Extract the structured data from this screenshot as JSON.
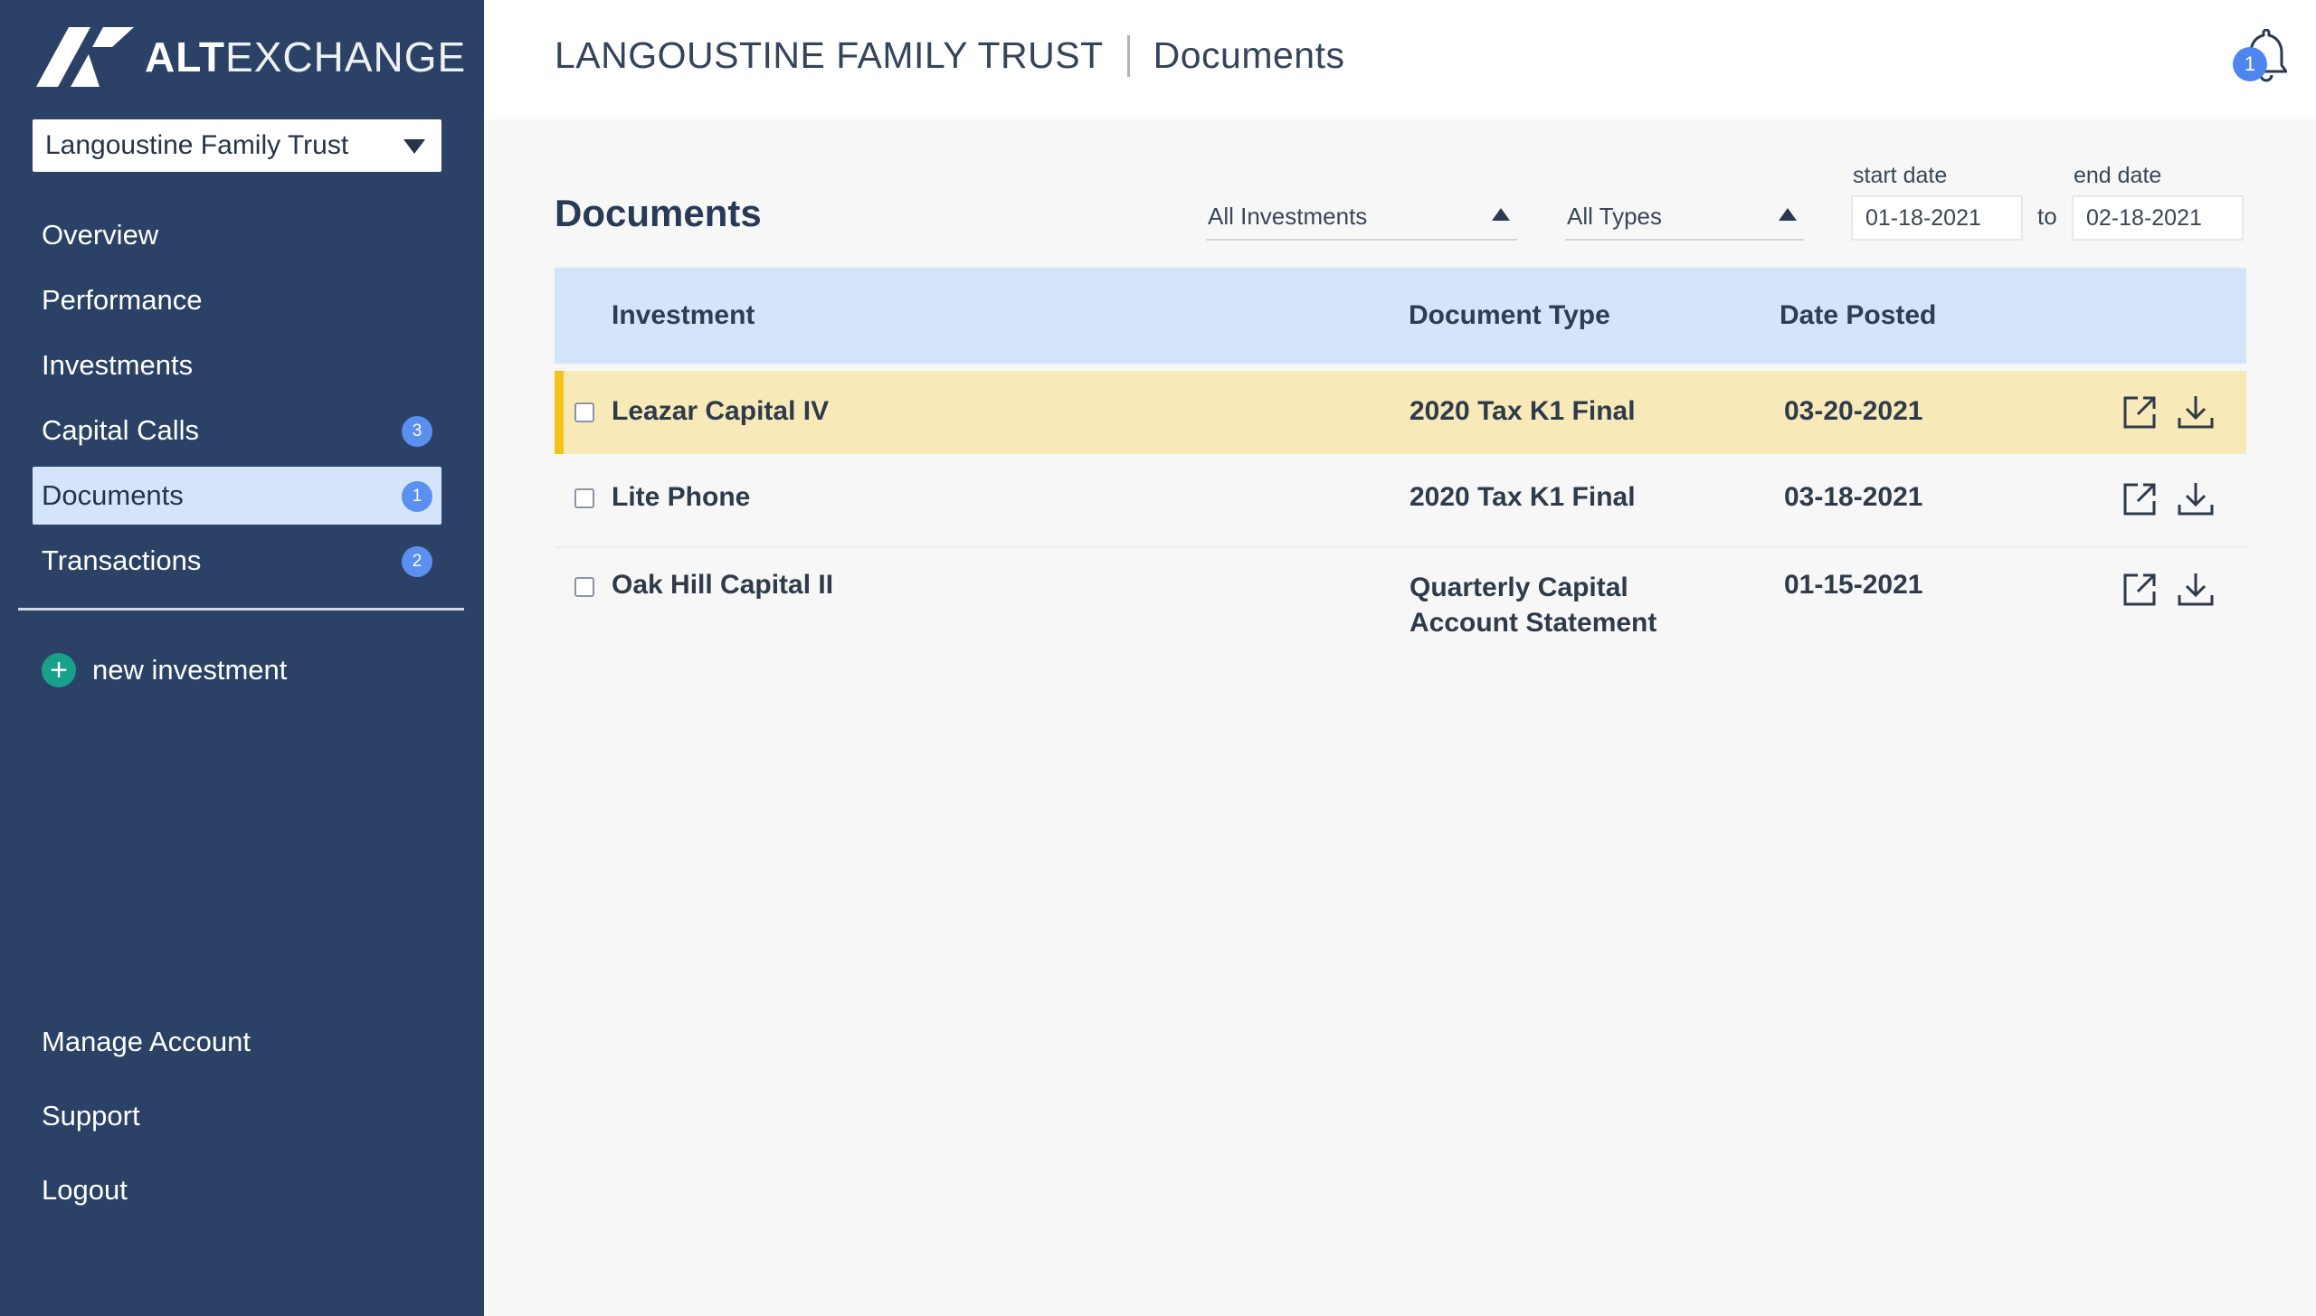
{
  "logo": {
    "text_bold": "ALT",
    "text_light": "EXCHANGE"
  },
  "account_selector": {
    "value": "Langoustine Family Trust"
  },
  "nav": {
    "items": [
      {
        "label": "Overview",
        "badge": null,
        "active": false
      },
      {
        "label": "Performance",
        "badge": null,
        "active": false
      },
      {
        "label": "Investments",
        "badge": null,
        "active": false
      },
      {
        "label": "Capital Calls",
        "badge": "3",
        "active": false
      },
      {
        "label": "Documents",
        "badge": "1",
        "active": true
      },
      {
        "label": "Transactions",
        "badge": "2",
        "active": false
      }
    ],
    "new_investment": "new investment",
    "bottom": [
      "Manage Account",
      "Support",
      "Logout"
    ]
  },
  "header": {
    "entity": "LANGOUSTINE FAMILY TRUST",
    "page": "Documents",
    "notification_count": "1"
  },
  "main": {
    "title": "Documents",
    "filters": {
      "investment": "All Investments",
      "type": "All Types",
      "start_label": "start date",
      "start_value": "01-18-2021",
      "to_label": "to",
      "end_label": "end date",
      "end_value": "02-18-2021"
    },
    "table": {
      "headers": {
        "investment": "Investment",
        "type": "Document Type",
        "date": "Date Posted"
      },
      "rows": [
        {
          "investment": "Leazar Capital IV",
          "type_line1": "2020 Tax K1 Final",
          "type_line2": "",
          "date": "03-20-2021",
          "highlighted": true
        },
        {
          "investment": "Lite Phone",
          "type_line1": "2020 Tax K1 Final",
          "type_line2": "",
          "date": "03-18-2021",
          "highlighted": false
        },
        {
          "investment": "Oak Hill Capital II",
          "type_line1": "Quarterly Capital",
          "type_line2": "Account Statement",
          "date": "01-15-2021",
          "highlighted": false
        }
      ]
    }
  },
  "colors": {
    "sidebar_bg": "#2b4266",
    "active_nav_bg": "#d4e4fb",
    "badge": "#5b8ff0",
    "highlight_row": "#f8eab8",
    "highlight_bar": "#f2c418",
    "add_button": "#17a08a"
  },
  "icons": {
    "logo": "altexchange-logo-icon",
    "caret": "chevron-down-icon",
    "notification": "bell-icon",
    "open": "external-link-icon",
    "download": "download-icon",
    "add": "plus-circle-icon"
  }
}
